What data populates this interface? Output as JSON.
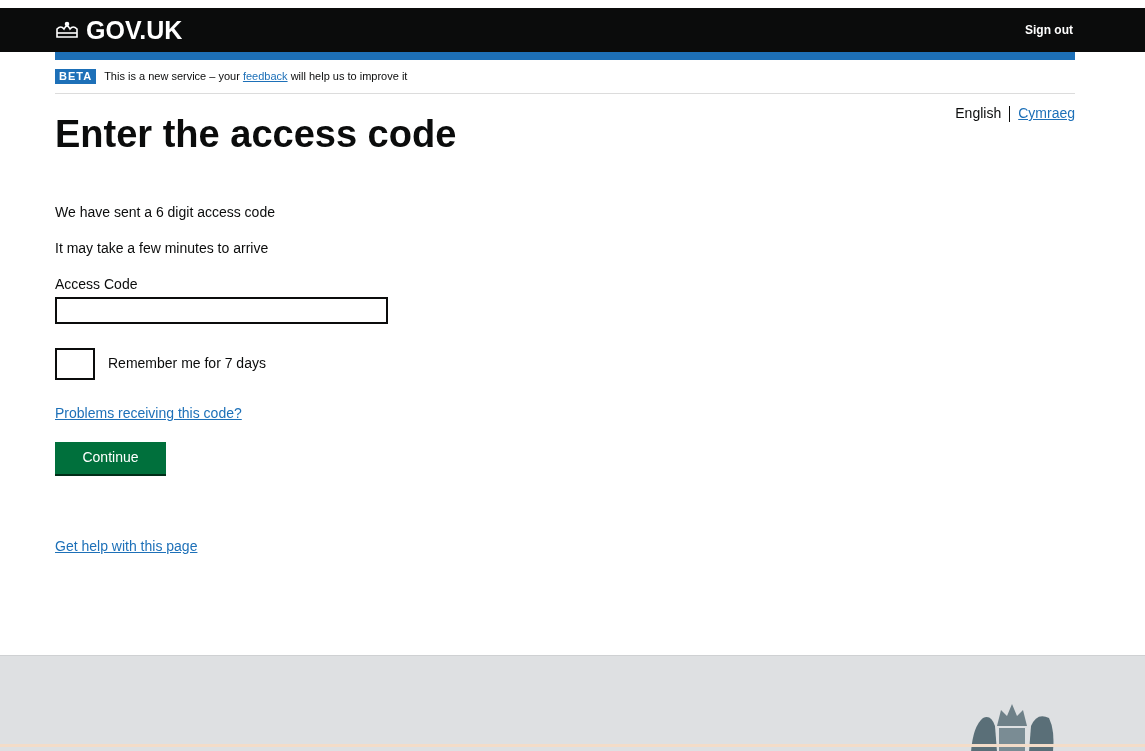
{
  "header": {
    "logo": "GOV.UK",
    "sign_out": "Sign out"
  },
  "phase_banner": {
    "tag": "BETA",
    "text_before": "This is a new service – your",
    "link": "feedback",
    "text_after": "will help us to improve it"
  },
  "languages": [
    {
      "label": "English",
      "selected": true
    },
    {
      "label": "Cymraeg",
      "selected": false
    }
  ],
  "heading": "Enter the access code",
  "paragraphs": [
    "We have sent a 6 digit access code",
    "It may take a few minutes to arrive"
  ],
  "access_code": {
    "label": "Access Code"
  },
  "remember": {
    "label": "Remember me for 7 days",
    "checked": false
  },
  "problems_link": "Problems receiving this code?",
  "continue_button": "Continue",
  "help_link": "Get help with this page"
}
